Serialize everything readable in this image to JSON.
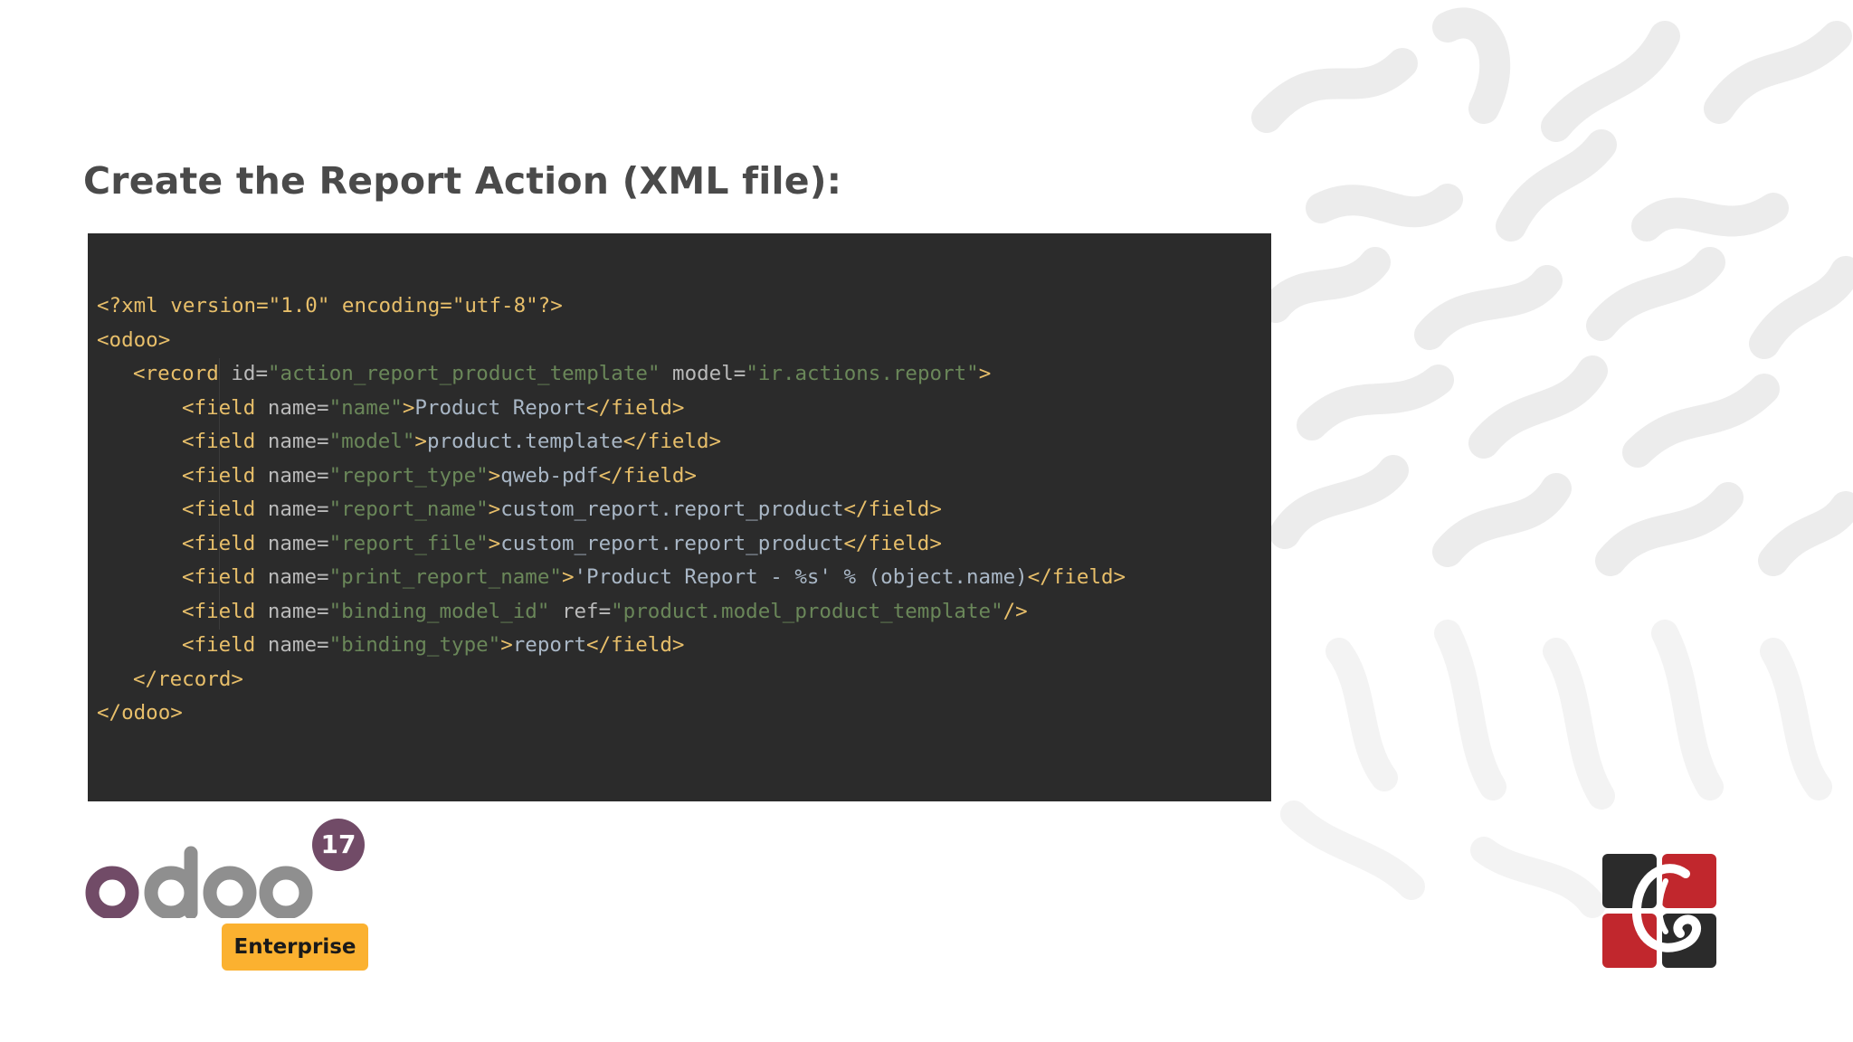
{
  "title": "Create the Report Action (XML file):",
  "code": {
    "xml_decl": "<?xml version=\"1.0\" encoding=\"utf-8\"?>",
    "lines": {
      "l1_open": "<odoo>",
      "l2_record_open": "<record",
      "l2_id_attr": "id=",
      "l2_id_val": "\"action_report_product_template\"",
      "l2_model_attr": "model=",
      "l2_model_val": "\"ir.actions.report\"",
      "l2_close": ">",
      "f_open": "<field",
      "name_attr": "name=",
      "f1_val": "\"name\"",
      "f1_text": "Product Report",
      "f2_val": "\"model\"",
      "f2_text": "product.template",
      "f3_val": "\"report_type\"",
      "f3_text": "qweb-pdf",
      "f4_val": "\"report_name\"",
      "f4_text": "custom_report.report_product",
      "f5_val": "\"report_file\"",
      "f5_text": "custom_report.report_product",
      "f6_val": "\"print_report_name\"",
      "f6_text": "'Product Report - %s' % (object.name)",
      "f7_val": "\"binding_model_id\"",
      "f7_ref_attr": "ref=",
      "f7_ref_val": "\"product.model_product_template\"",
      "f7_close": "/>",
      "f8_val": "\"binding_type\"",
      "f8_text": "report",
      "gt": ">",
      "field_close": "</field>",
      "record_close": "</record>",
      "odoo_close": "</odoo>"
    }
  },
  "logo": {
    "brand": "odoo",
    "version": "17",
    "edition": "Enterprise"
  },
  "colors": {
    "odoo_purple": "#714b67",
    "odoo_gray": "#8f8f8f",
    "enterprise_yellow": "#fbb130",
    "code_bg": "#2b2b2b",
    "company_red": "#c1272d",
    "company_dark": "#2b2b2b"
  }
}
